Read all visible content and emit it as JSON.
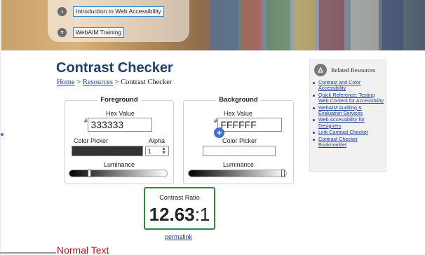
{
  "banner": {
    "links": [
      {
        "label": "Introduction to Web Accessibility"
      },
      {
        "label": "WebAIM Training"
      }
    ]
  },
  "page": {
    "title": "Contrast Checker",
    "breadcrumb": {
      "home": "Home",
      "sep1": " > ",
      "resources": "Resources",
      "sep2": " > ",
      "current": "Contrast Checker"
    }
  },
  "foreground": {
    "legend": "Foreground",
    "hex_label": "Hex Value",
    "hash": "#",
    "hex_value": "333333",
    "picker_label": "Color Picker",
    "alpha_label": "Alpha",
    "alpha_value": "1",
    "luminance_label": "Luminance",
    "color": "#333333",
    "luminance": 0.2
  },
  "background": {
    "legend": "Background",
    "hex_label": "Hex Value",
    "hash": "#",
    "hex_value": "FFFFFF",
    "picker_label": "Color Picker",
    "luminance_label": "Luminance",
    "color": "#ffffff",
    "luminance": 1.0
  },
  "add_button": {
    "label": "+"
  },
  "contrast": {
    "label": "Contrast Ratio",
    "ratio_main": "12.63",
    "ratio_suffix": ":1",
    "permalink": "permalink"
  },
  "sections": {
    "normal_text": "Normal Text"
  },
  "sidebar": {
    "title": "Related Resources",
    "items": [
      {
        "label": "Contrast and Color Accessibility"
      },
      {
        "label": "Quick Reference: Testing Web Content for Accessibility"
      },
      {
        "label": "WebAIM Auditing & Evaluation Services"
      },
      {
        "label": "Web Accessibility for Designers"
      },
      {
        "label": "Link Contrast Checker"
      },
      {
        "label": "Contrast Checker Bookmarklet"
      }
    ]
  },
  "colors": {
    "title": "#1f3f6e",
    "link": "#1f3f9a",
    "pass_border": "#2a8c3a",
    "heading_red": "#b8121b"
  }
}
